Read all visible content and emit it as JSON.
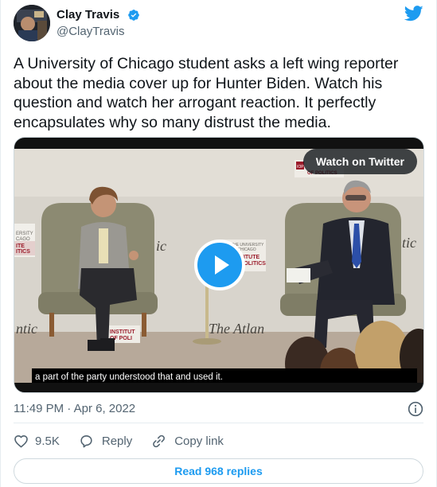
{
  "author": {
    "name": "Clay Travis",
    "handle": "@ClayTravis",
    "verified": true
  },
  "tweet": {
    "text": "A University of Chicago student asks a left wing reporter about the media cover up for Hunter Biden. Watch his question and watch her arrogant reaction. It perfectly encapsulates why so many distrust the media.",
    "timestamp": "11:49 PM · Apr 6, 2022"
  },
  "media": {
    "watch_label": "Watch on Twitter",
    "subtitle": "a part of the party understood that and used it.",
    "backdrop": {
      "banner_left": [
        "ERSITY",
        "CAGO",
        "ITE",
        "ITICS"
      ],
      "banner_center": [
        "THE UNIVERSITY",
        "OF CHICAGO",
        "INSTITUTE",
        "OF POLITICS"
      ],
      "banner_top_right": [
        "IOP",
        "OF POLITICS"
      ],
      "banner_bottom_left": [
        "INSTITUT",
        "OF POLI"
      ],
      "logo_fragments": [
        "ic",
        "ntic",
        "ntic",
        "The Atlan"
      ]
    }
  },
  "actions": {
    "likes": "9.5K",
    "reply": "Reply",
    "copy_link": "Copy link",
    "read_replies": "Read 968 replies"
  },
  "colors": {
    "accent": "#1d9bf0",
    "text_primary": "#0f1419",
    "text_secondary": "#536471",
    "border": "#cfd9de"
  },
  "icons": [
    "verified-badge-icon",
    "twitter-bird-icon",
    "play-icon",
    "info-icon",
    "heart-icon",
    "reply-bubble-icon",
    "link-icon"
  ]
}
